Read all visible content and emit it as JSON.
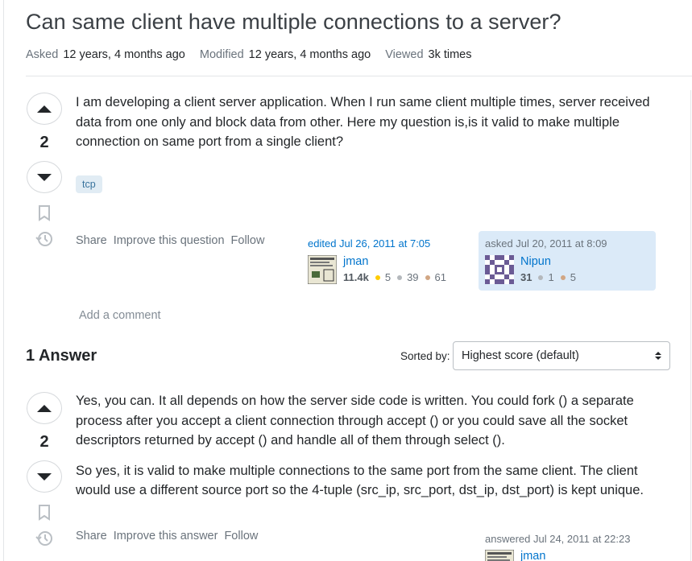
{
  "question": {
    "title": "Can same client have multiple connections to a server?",
    "meta": {
      "asked_label": "Asked",
      "asked_value": "12 years, 4 months ago",
      "modified_label": "Modified",
      "modified_value": "12 years, 4 months ago",
      "viewed_label": "Viewed",
      "viewed_value": "3k times"
    },
    "votes": "2",
    "body": [
      "I am developing a client server application. When I run same client multiple times, server received data from one only and block data from other. Here my question is,is it valid to make multiple connection on same port from a single client?"
    ],
    "tags": [
      "tcp"
    ],
    "actions": {
      "share": "Share",
      "improve": "Improve this question",
      "follow": "Follow"
    },
    "edited": {
      "when": "edited Jul 26, 2011 at 7:05",
      "user": "jman",
      "rep": "11.4k",
      "gold": "5",
      "silver": "39",
      "bronze": "61"
    },
    "asked": {
      "when": "asked Jul 20, 2011 at 8:09",
      "user": "Nipun",
      "rep": "31",
      "silver": "1",
      "bronze": "5"
    },
    "add_comment": "Add a comment"
  },
  "answers_header": {
    "count_label": "1 Answer",
    "sort_label": "Sorted by:",
    "sort_value": "Highest score (default)"
  },
  "answer": {
    "votes": "2",
    "body": [
      "Yes, you can. It all depends on how the server side code is written. You could fork () a separate process after you accept a client connection through accept () or you could save all the socket descriptors returned by accept () and handle all of them through select ().",
      "So yes, it is valid to make multiple connections to the same port from the same client. The client would use a different source port so the 4-tuple (src_ip, src_port, dst_ip, dst_port) is kept unique."
    ],
    "actions": {
      "share": "Share",
      "improve": "Improve this answer",
      "follow": "Follow"
    },
    "answered": {
      "when": "answered Jul 24, 2011 at 22:23",
      "user": "jman"
    }
  },
  "colors": {
    "link": "#0074cc",
    "muted": "#6a737c",
    "tag_bg": "#e1ecf4",
    "tag_fg": "#39739d",
    "owner_bg": "#dbeaf8",
    "gold": "#ffcc01",
    "silver": "#b4b8bc",
    "bronze": "#d1a684"
  },
  "icons": [
    "upvote-icon",
    "downvote-icon",
    "bookmark-icon",
    "history-icon",
    "sort-chevrons-icon"
  ]
}
